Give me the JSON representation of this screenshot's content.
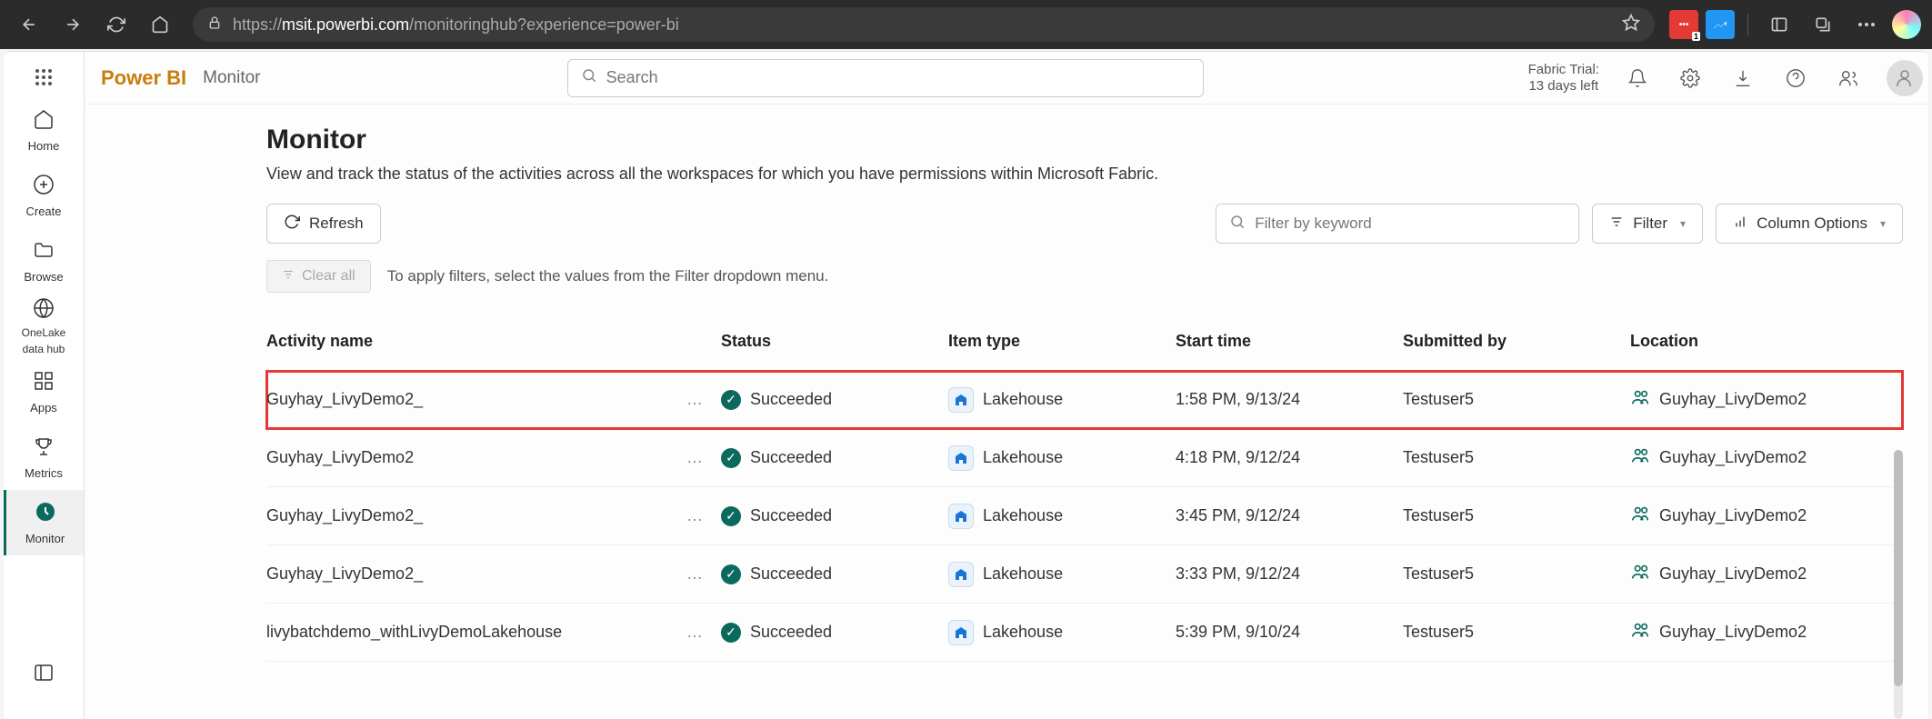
{
  "browser": {
    "url_domain": "msit.powerbi.com",
    "url_path": "/monitoringhub?experience=power-bi",
    "url_prefix": "https://"
  },
  "header": {
    "brand": "Power BI",
    "breadcrumb": "Monitor",
    "search_placeholder": "Search",
    "trial_line1": "Fabric Trial:",
    "trial_line2": "13 days left"
  },
  "rail": {
    "home": "Home",
    "create": "Create",
    "browse": "Browse",
    "onelake1": "OneLake",
    "onelake2": "data hub",
    "apps": "Apps",
    "metrics": "Metrics",
    "monitor": "Monitor"
  },
  "page": {
    "title": "Monitor",
    "description": "View and track the status of the activities across all the workspaces for which you have permissions within Microsoft Fabric.",
    "refresh": "Refresh",
    "filter_placeholder": "Filter by keyword",
    "filter_btn": "Filter",
    "column_options": "Column Options",
    "clear_all": "Clear all",
    "hint": "To apply filters, select the values from the Filter dropdown menu."
  },
  "table": {
    "headers": {
      "activity": "Activity name",
      "status": "Status",
      "item_type": "Item type",
      "start_time": "Start time",
      "submitted_by": "Submitted by",
      "location": "Location"
    },
    "rows": [
      {
        "name": "Guyhay_LivyDemo2_",
        "status": "Succeeded",
        "item_type": "Lakehouse",
        "start_time": "1:58 PM, 9/13/24",
        "submitted_by": "Testuser5",
        "location": "Guyhay_LivyDemo2",
        "highlight": true
      },
      {
        "name": "Guyhay_LivyDemo2",
        "status": "Succeeded",
        "item_type": "Lakehouse",
        "start_time": "4:18 PM, 9/12/24",
        "submitted_by": "Testuser5",
        "location": "Guyhay_LivyDemo2",
        "highlight": false
      },
      {
        "name": "Guyhay_LivyDemo2_",
        "status": "Succeeded",
        "item_type": "Lakehouse",
        "start_time": "3:45 PM, 9/12/24",
        "submitted_by": "Testuser5",
        "location": "Guyhay_LivyDemo2",
        "highlight": false
      },
      {
        "name": "Guyhay_LivyDemo2_",
        "status": "Succeeded",
        "item_type": "Lakehouse",
        "start_time": "3:33 PM, 9/12/24",
        "submitted_by": "Testuser5",
        "location": "Guyhay_LivyDemo2",
        "highlight": false
      },
      {
        "name": "livybatchdemo_withLivyDemoLakehouse",
        "status": "Succeeded",
        "item_type": "Lakehouse",
        "start_time": "5:39 PM, 9/10/24",
        "submitted_by": "Testuser5",
        "location": "Guyhay_LivyDemo2",
        "highlight": false
      }
    ]
  }
}
